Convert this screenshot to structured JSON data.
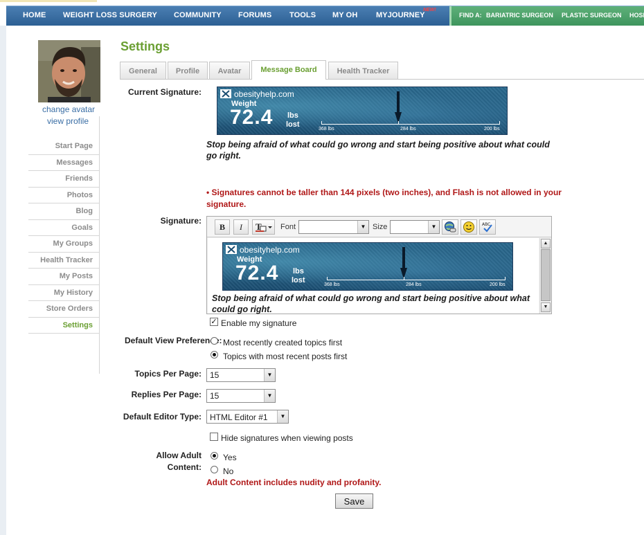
{
  "nav": {
    "items": [
      "HOME",
      "WEIGHT LOSS SURGERY",
      "COMMUNITY",
      "FORUMS",
      "TOOLS",
      "MY OH",
      "MYJOURNEY"
    ],
    "new_badge": "NEW!",
    "find_label": "FIND A:",
    "find_items": [
      "BARIATRIC SURGEON",
      "PLASTIC SURGEON",
      "HOSP"
    ]
  },
  "sidebar": {
    "change_avatar": "change avatar",
    "view_profile": "view profile",
    "menu": [
      "Start Page",
      "Messages",
      "Friends",
      "Photos",
      "Blog",
      "Goals",
      "My Groups",
      "Health Tracker",
      "My Posts",
      "My History",
      "Store Orders",
      "Settings"
    ],
    "active": "Settings"
  },
  "page": {
    "title": "Settings",
    "tabs": [
      "General",
      "Profile",
      "Avatar",
      "Message Board",
      "Health Tracker"
    ],
    "active_tab": "Message Board"
  },
  "form": {
    "current_signature_label": "Current Signature:",
    "signature_label": "Signature:",
    "signature_text": "Stop being afraid of what could go wrong and start being positive about what could go right.",
    "warning": "• Signatures cannot be taller than 144 pixels (two inches), and Flash is not allowed in your signature.",
    "editor": {
      "bold": "B",
      "italic": "I",
      "font_label": "Font",
      "font_value": "",
      "size_label": "Size",
      "size_value": ""
    },
    "enable_signature": "Enable my signature",
    "enable_signature_checked": true,
    "default_view_label": "Default View Preference:",
    "view_options": [
      "Most recently created topics first",
      "Topics with most recent posts first"
    ],
    "view_selected": 1,
    "topics_per_page_label": "Topics Per Page:",
    "topics_per_page": "15",
    "replies_per_page_label": "Replies Per Page:",
    "replies_per_page": "15",
    "editor_type_label": "Default Editor Type:",
    "editor_type": "HTML Editor #1",
    "hide_signatures": "Hide signatures when viewing posts",
    "hide_signatures_checked": false,
    "adult_label": "Allow Adult Content:",
    "adult_options": [
      "Yes",
      "No"
    ],
    "adult_selected": 0,
    "adult_note": "Adult Content includes nudity and profanity.",
    "save": "Save"
  },
  "banner": {
    "site": "obesityhelp.com",
    "weight_label": "Weight",
    "lost_value": "72.4",
    "unit_top": "lbs",
    "unit_bottom": "lost",
    "scale_start": "368 lbs",
    "scale_mid": "284 lbs",
    "scale_end": "200 lbs",
    "progress_fraction": 0.43
  },
  "colors": {
    "nav_blue": "#2c5f93",
    "find_green": "#3e955d",
    "accent_green": "#6a9f32",
    "warning_red": "#b01818",
    "link_blue": "#3a6ea5"
  }
}
